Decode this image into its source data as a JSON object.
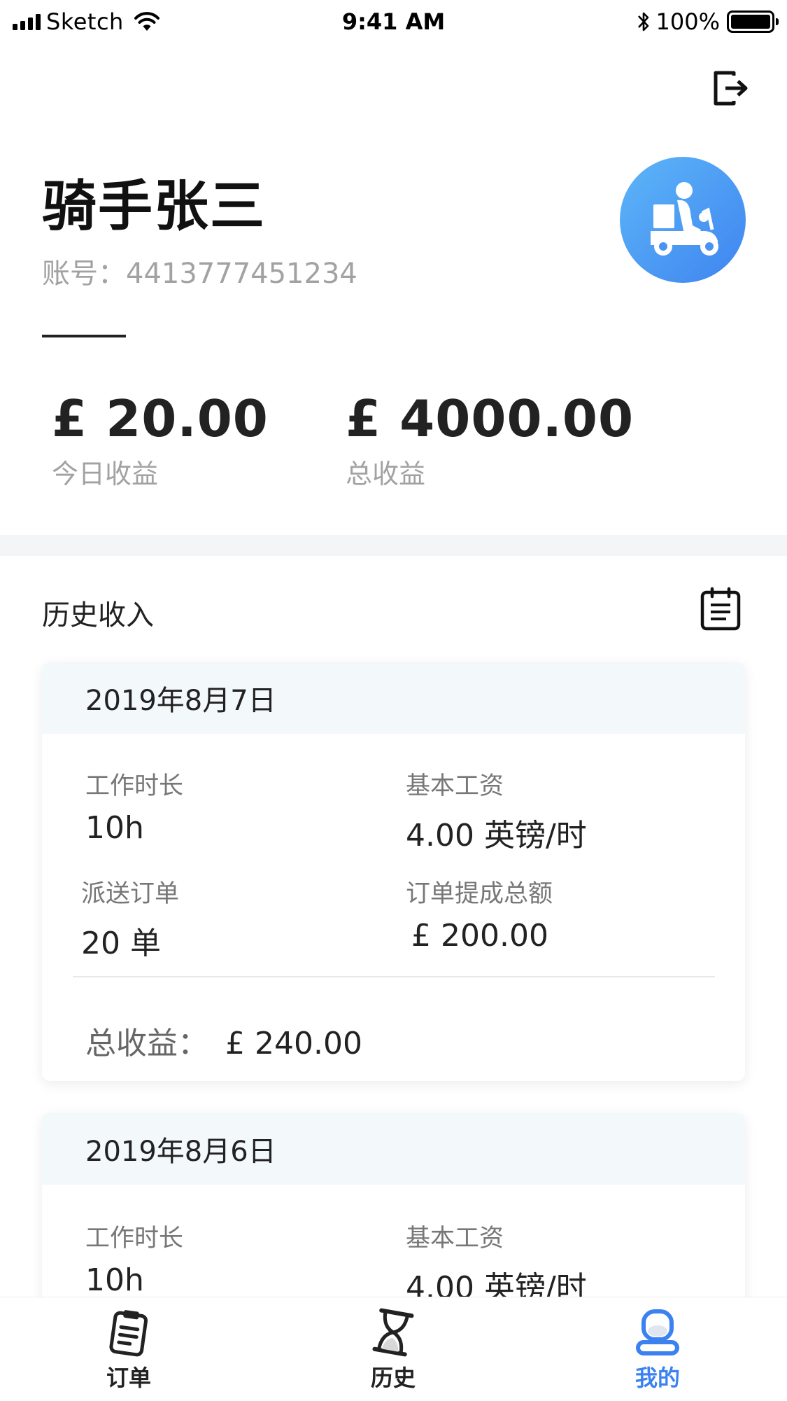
{
  "status_bar": {
    "carrier": "Sketch",
    "time": "9:41 AM",
    "battery": "100%"
  },
  "profile": {
    "name": "骑手张三",
    "account": "账号：4413777451234"
  },
  "earnings": {
    "today_amount": "£ 20.00",
    "today_label": "今日收益",
    "total_amount": "£ 4000.00",
    "total_label": "总收益"
  },
  "history": {
    "title": "历史收入",
    "cards": [
      {
        "date": "2019年8月7日",
        "hours_label": "工作时长",
        "hours_value": "10h",
        "wage_label": "基本工资",
        "wage_value": "4.00 英镑/时",
        "orders_label": "派送订单",
        "orders_value": "20 单",
        "commission_label": "订单提成总额",
        "commission_value": "£ 200.00",
        "total_label": "总收益：",
        "total_value": "£ 240.00"
      },
      {
        "date": "2019年8月6日",
        "hours_label": "工作时长",
        "hours_value": "10h",
        "wage_label": "基本工资",
        "wage_value": "4.00 英镑/时"
      }
    ]
  },
  "tabs": [
    {
      "label": "订单",
      "icon": "clipboard-icon",
      "active": false
    },
    {
      "label": "历史",
      "icon": "hourglass-icon",
      "active": false
    },
    {
      "label": "我的",
      "icon": "profile-icon",
      "active": true
    }
  ],
  "colors": {
    "accent": "#3b82f0",
    "avatar_gradient_start": "#5db6f8",
    "avatar_gradient_end": "#3f84f0",
    "card_header_bg": "#f3f8fb",
    "muted_text": "#a2a2a2"
  }
}
